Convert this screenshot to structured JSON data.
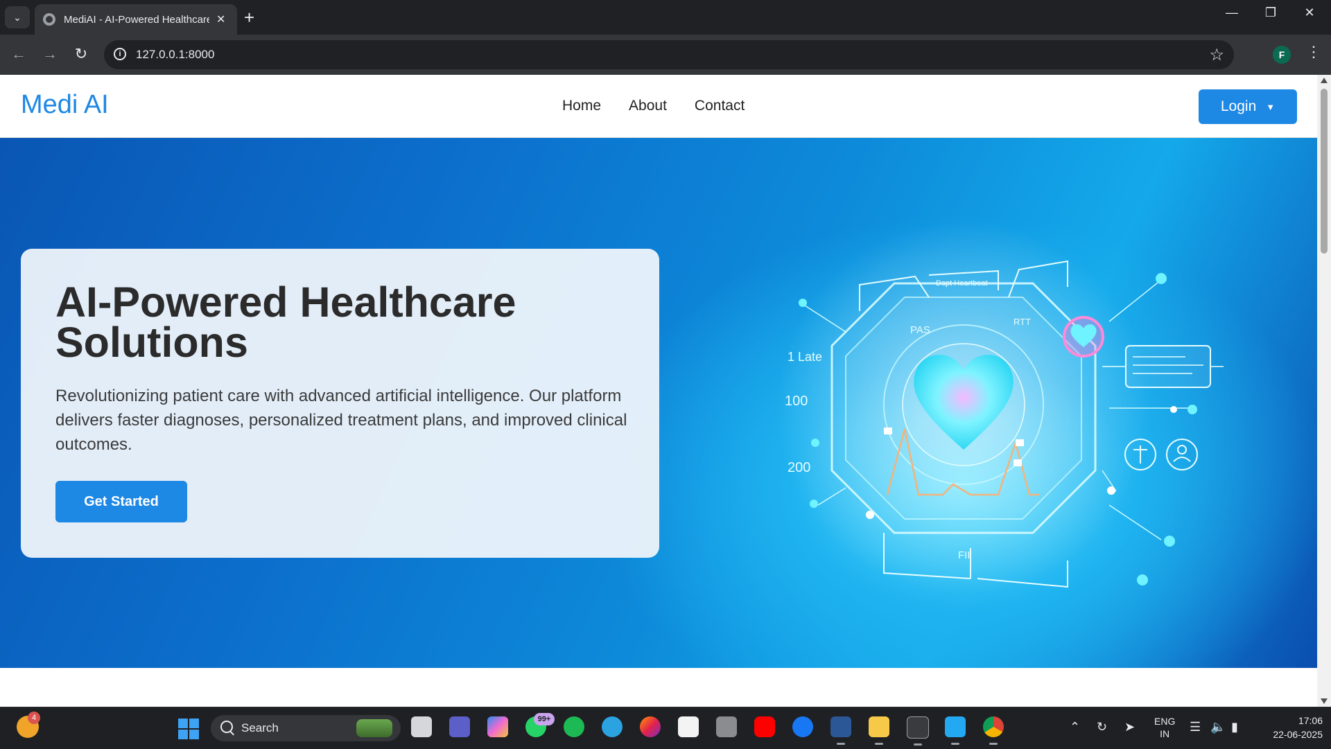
{
  "browser": {
    "tab_title": "MediAI - AI-Powered Healthcare",
    "url": "127.0.0.1:8000",
    "profile_initial": "F"
  },
  "site": {
    "brand": "Medi AI",
    "nav": [
      "Home",
      "About",
      "Contact"
    ],
    "login_label": "Login"
  },
  "hero": {
    "title": "AI-Powered Healthcare Solutions",
    "subtitle": "Revolutionizing patient care with advanced artificial intelligence. Our platform delivers faster diagnoses, personalized treatment plans, and improved clinical outcomes.",
    "cta_label": "Get Started",
    "illustration": {
      "icon": "holographic-heart-illustration",
      "labels": [
        "Dapt Heartbeat",
        "PAS",
        "RTT",
        "1 Late",
        "100",
        "200",
        "FII"
      ]
    }
  },
  "taskbar": {
    "weather_badge": "4",
    "search_label": "Search",
    "whatsapp_badge": "99+",
    "lang_line1": "ENG",
    "lang_line2": "IN",
    "time": "17:06",
    "date": "22-06-2025"
  },
  "colors": {
    "accent": "#1e88e5",
    "hero_blue": "#0c6fcc",
    "hero_cyan": "#5ee2ff"
  }
}
